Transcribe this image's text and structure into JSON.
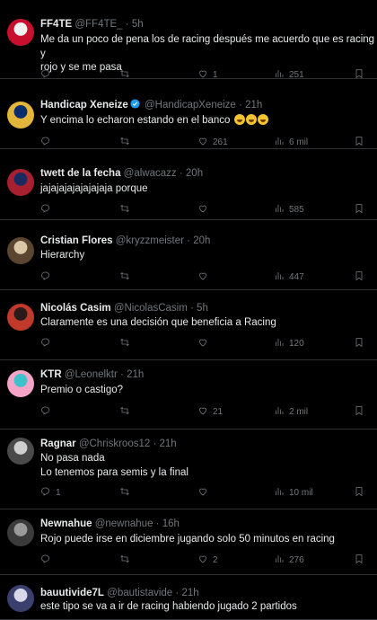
{
  "tweets": [
    {
      "name": "FF4TE",
      "handle": "@FF4TE_",
      "sep": "·",
      "time": "5h",
      "text": "Me da un poco de pena los de racing después me acuerdo que es racing y\nrojo y se me pasa",
      "replies": "",
      "retweets": "",
      "likes": "1",
      "views": "251",
      "avatar_colors": [
        "#f2f2f2",
        "#c8102e"
      ]
    },
    {
      "name": "Handicap Xeneize",
      "verified": true,
      "handle": "@HandicapXeneize",
      "sep": "·",
      "time": "21h",
      "text": "Y encima lo echaron estando en el banco",
      "emoji": [
        "rofl",
        "rofl",
        "rofl"
      ],
      "replies": "",
      "retweets": "",
      "likes": "261",
      "views": "6 mil",
      "avatar_colors": [
        "#0a2d6e",
        "#e3b53b"
      ]
    },
    {
      "name": "twett de la fecha",
      "handle": "@alwacazz",
      "sep": "·",
      "time": "20h",
      "text": "jajajajajajajajaja porque",
      "replies": "",
      "retweets": "",
      "likes": "",
      "views": "585",
      "avatar_colors": [
        "#1b2a5e",
        "#a8202f"
      ]
    },
    {
      "name": "Cristian Flores",
      "handle": "@kryzzmeister",
      "sep": "·",
      "time": "20h",
      "text": "Hierarchy",
      "replies": "",
      "retweets": "",
      "likes": "",
      "views": "447",
      "avatar_colors": [
        "#d9c7a8",
        "#5a4630"
      ]
    },
    {
      "name": "Nicolás Casim",
      "handle": "@NicolasCasim",
      "sep": "·",
      "time": "5h",
      "text": "Claramente es una decisión que beneficia a Racing",
      "replies": "",
      "retweets": "",
      "likes": "",
      "views": "120",
      "avatar_colors": [
        "#2a1a1a",
        "#c0392b"
      ]
    },
    {
      "name": "KTR",
      "handle": "@Leonelktr",
      "sep": "·",
      "time": "21h",
      "text": "Premio o castigo?",
      "replies": "",
      "retweets": "",
      "likes": "21",
      "views": "2 mil",
      "avatar_colors": [
        "#3fc1c9",
        "#f5a3c7"
      ]
    },
    {
      "name": "Ragnar",
      "handle": "@Chriskroos12",
      "sep": "·",
      "time": "21h",
      "text": "No pasa nada\nLo tenemos para semis y la final",
      "replies": "1",
      "retweets": "",
      "likes": "",
      "views": "10 mil",
      "avatar_colors": [
        "#cfcfcf",
        "#4a4a4a"
      ]
    },
    {
      "name": "Newnahue",
      "handle": "@newnahue",
      "sep": "·",
      "time": "16h",
      "text": "Rojo puede irse en diciembre jugando solo 50 minutos en racing",
      "replies": "",
      "retweets": "",
      "likes": "2",
      "views": "276",
      "avatar_colors": [
        "#9a9a9a",
        "#3a3a3a"
      ]
    },
    {
      "name": "bauutivide7L",
      "handle": "@bautistavide",
      "sep": "·",
      "time": "21h",
      "text": "este tipo se va a ir de racing habiendo jugado 2 partidos",
      "replies": "",
      "retweets": "",
      "likes": "",
      "views": "",
      "avatar_colors": [
        "#d8d8e8",
        "#3b3f6e"
      ]
    }
  ]
}
